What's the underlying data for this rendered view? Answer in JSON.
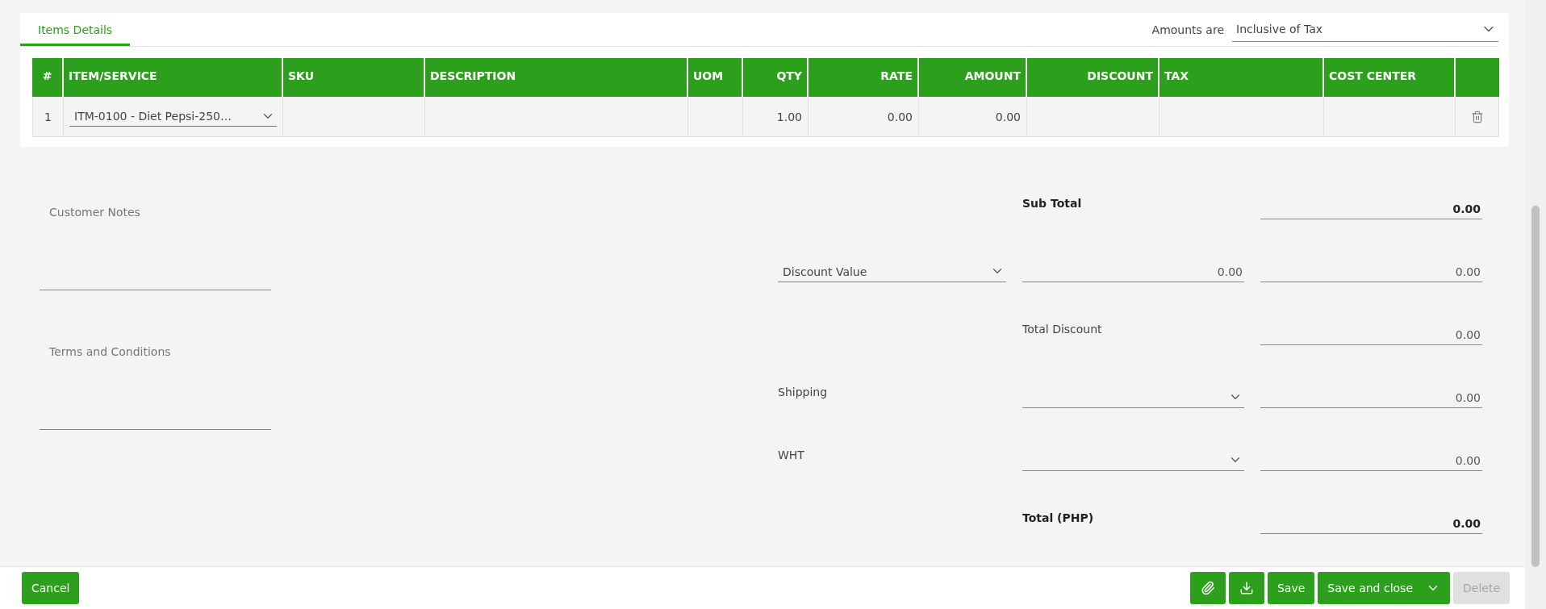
{
  "tab": {
    "label": "Items Details",
    "selected": true
  },
  "amounts": {
    "label": "Amounts are",
    "value": "Inclusive of Tax"
  },
  "table": {
    "columns": [
      {
        "label": "#"
      },
      {
        "label": "ITEM/SERVICE"
      },
      {
        "label": "SKU"
      },
      {
        "label": "DESCRIPTION"
      },
      {
        "label": "UOM"
      },
      {
        "label": "QTY"
      },
      {
        "label": "RATE"
      },
      {
        "label": "AMOUNT"
      },
      {
        "label": "DISCOUNT"
      },
      {
        "label": "TAX"
      },
      {
        "label": "COST CENTER"
      }
    ],
    "rows": [
      {
        "number": "1",
        "item": "ITM-0100 - Diet Pepsi-250…",
        "qty": "1.00",
        "rate": "0.00",
        "amount": "0.00"
      }
    ]
  },
  "notes": [
    {
      "label": "Customer Notes"
    },
    {
      "label": "Terms and Conditions"
    }
  ],
  "summary": [
    {
      "kind": "subtotal",
      "label": "Sub Total",
      "value": "0.00"
    },
    {
      "kind": "discount",
      "select": "Discount Value",
      "input": "0.00",
      "value": "0.00"
    },
    {
      "kind": "plain",
      "label": "Total Discount",
      "value": "0.00"
    },
    {
      "kind": "select",
      "label": "Shipping",
      "value": "0.00"
    },
    {
      "kind": "select",
      "label": "WHT",
      "value": "0.00"
    },
    {
      "kind": "total",
      "label": "Total (PHP)",
      "value": "0.00"
    }
  ],
  "footer": {
    "cancel": "Cancel",
    "actions": [
      {
        "kind": "attach"
      },
      {
        "kind": "download"
      },
      {
        "kind": "plain",
        "label": "Save",
        "disabled": false
      },
      {
        "kind": "split",
        "label": "Save and close",
        "disabled": false
      },
      {
        "kind": "plain",
        "label": "Delete",
        "disabled": true
      }
    ]
  }
}
